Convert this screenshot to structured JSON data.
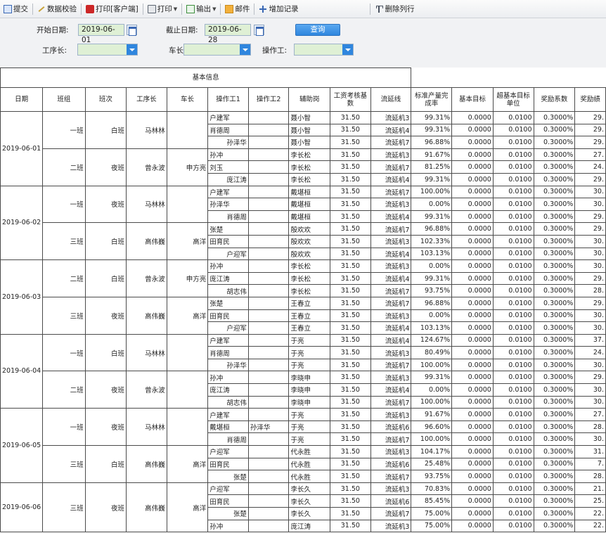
{
  "toolbar": {
    "submit": "提交",
    "validate": "数据校验",
    "print_client": "打印[客户端]",
    "print": "打印",
    "export": "输出",
    "mail": "邮件",
    "add_record": "增加记录",
    "delete_row": "删除列行"
  },
  "filters": {
    "start_label": "开始日期:",
    "start_value": "2019-06-01",
    "end_label": "截止日期:",
    "end_value": "2019-06-28",
    "query_label": "查询",
    "process_leader_label": "工序长:",
    "workshop_leader_label": "车长:",
    "operator_label": "操作工:"
  },
  "grid": {
    "group_header": "基本信息",
    "columns": [
      "日期",
      "班组",
      "班次",
      "工序长",
      "车长",
      "操作工1",
      "操作工2",
      "辅助岗",
      "工资考核基数",
      "流延线",
      "标准产量完成率",
      "基本目标",
      "超基本目标单位",
      "奖励系数",
      "奖励绩"
    ],
    "rows": [
      [
        "户建军",
        "",
        "聂小智",
        "31.50",
        "流延机3",
        "99.31%",
        "0.0000",
        "0.0100",
        "0.3000%",
        "29."
      ],
      [
        "肖德周",
        "",
        "聂小智",
        "31.50",
        "流延机4",
        "99.31%",
        "0.0000",
        "0.0100",
        "0.3000%",
        "29."
      ],
      [
        "孙泽华",
        "",
        "聂小智",
        "31.50",
        "流延机7",
        "96.88%",
        "0.0000",
        "0.0100",
        "0.3000%",
        "29."
      ],
      [
        "孙冲",
        "",
        "李长松",
        "31.50",
        "流延机3",
        "91.67%",
        "0.0000",
        "0.0100",
        "0.3000%",
        "27."
      ],
      [
        "刘玉",
        "",
        "李长松",
        "31.50",
        "流延机7",
        "81.25%",
        "0.0000",
        "0.0100",
        "0.3000%",
        "24."
      ],
      [
        "庞江涛",
        "",
        "李长松",
        "31.50",
        "流延机4",
        "99.31%",
        "0.0000",
        "0.0100",
        "0.3000%",
        "29."
      ],
      [
        "户建军",
        "",
        "戴堪桓",
        "31.50",
        "流延机7",
        "100.00%",
        "0.0000",
        "0.0100",
        "0.3000%",
        "30."
      ],
      [
        "孙泽华",
        "",
        "戴堪桓",
        "31.50",
        "流延机3",
        "0.00%",
        "0.0000",
        "0.0100",
        "0.3000%",
        "30."
      ],
      [
        "肖德周",
        "",
        "戴堪桓",
        "31.50",
        "流延机4",
        "99.31%",
        "0.0000",
        "0.0100",
        "0.3000%",
        "29."
      ],
      [
        "张楚",
        "",
        "殷欢欢",
        "31.50",
        "流延机7",
        "96.88%",
        "0.0000",
        "0.0100",
        "0.3000%",
        "29."
      ],
      [
        "田育民",
        "",
        "殷欢欢",
        "31.50",
        "流延机3",
        "102.33%",
        "0.0000",
        "0.0100",
        "0.3000%",
        "30."
      ],
      [
        "户迎军",
        "",
        "殷欢欢",
        "31.50",
        "流延机4",
        "103.13%",
        "0.0000",
        "0.0100",
        "0.3000%",
        "30."
      ],
      [
        "孙冲",
        "",
        "李长松",
        "31.50",
        "流延机3",
        "0.00%",
        "0.0000",
        "0.0100",
        "0.3000%",
        "30."
      ],
      [
        "庞江涛",
        "",
        "李长松",
        "31.50",
        "流延机4",
        "99.31%",
        "0.0000",
        "0.0100",
        "0.3000%",
        "29."
      ],
      [
        "胡志伟",
        "",
        "李长松",
        "31.50",
        "流延机7",
        "93.75%",
        "0.0000",
        "0.0100",
        "0.3000%",
        "28."
      ],
      [
        "张楚",
        "",
        "王春立",
        "31.50",
        "流延机7",
        "96.88%",
        "0.0000",
        "0.0100",
        "0.3000%",
        "29."
      ],
      [
        "田育民",
        "",
        "王春立",
        "31.50",
        "流延机3",
        "0.00%",
        "0.0000",
        "0.0100",
        "0.3000%",
        "30."
      ],
      [
        "户迎军",
        "",
        "王春立",
        "31.50",
        "流延机4",
        "103.13%",
        "0.0000",
        "0.0100",
        "0.3000%",
        "30."
      ],
      [
        "户建军",
        "",
        "于亮",
        "31.50",
        "流延机4",
        "124.67%",
        "0.0000",
        "0.0100",
        "0.3000%",
        "37."
      ],
      [
        "肖德周",
        "",
        "于亮",
        "31.50",
        "流延机3",
        "80.49%",
        "0.0000",
        "0.0100",
        "0.3000%",
        "24."
      ],
      [
        "孙泽华",
        "",
        "于亮",
        "31.50",
        "流延机7",
        "100.00%",
        "0.0000",
        "0.0100",
        "0.3000%",
        "30."
      ],
      [
        "孙冲",
        "",
        "李晓申",
        "31.50",
        "流延机3",
        "99.31%",
        "0.0000",
        "0.0100",
        "0.3000%",
        "29."
      ],
      [
        "庞江涛",
        "",
        "李晓申",
        "31.50",
        "流延机4",
        "0.00%",
        "0.0000",
        "0.0100",
        "0.3000%",
        "30."
      ],
      [
        "胡志伟",
        "",
        "李晓申",
        "31.50",
        "流延机7",
        "100.00%",
        "0.0000",
        "0.0100",
        "0.3000%",
        "30."
      ],
      [
        "户建军",
        "",
        "于亮",
        "31.50",
        "流延机3",
        "91.67%",
        "0.0000",
        "0.0100",
        "0.3000%",
        "27."
      ],
      [
        "戴堪桓",
        "孙泽华",
        "于亮",
        "31.50",
        "流延机6",
        "96.60%",
        "0.0000",
        "0.0100",
        "0.3000%",
        "28."
      ],
      [
        "肖德周",
        "",
        "于亮",
        "31.50",
        "流延机7",
        "100.00%",
        "0.0000",
        "0.0100",
        "0.3000%",
        "30."
      ],
      [
        "户迎军",
        "",
        "代永胜",
        "31.50",
        "流延机3",
        "104.17%",
        "0.0000",
        "0.0100",
        "0.3000%",
        "31."
      ],
      [
        "田育民",
        "",
        "代永胜",
        "31.50",
        "流延机6",
        "25.48%",
        "0.0000",
        "0.0100",
        "0.3000%",
        "7."
      ],
      [
        "张楚",
        "",
        "代永胜",
        "31.50",
        "流延机7",
        "93.75%",
        "0.0000",
        "0.0100",
        "0.3000%",
        "28."
      ],
      [
        "户迎军",
        "",
        "李长久",
        "31.50",
        "流延机3",
        "70.83%",
        "0.0000",
        "0.0100",
        "0.3000%",
        "21."
      ],
      [
        "田育民",
        "",
        "李长久",
        "31.50",
        "流延机6",
        "85.45%",
        "0.0000",
        "0.0100",
        "0.3000%",
        "25."
      ],
      [
        "张楚",
        "",
        "李长久",
        "31.50",
        "流延机7",
        "75.00%",
        "0.0000",
        "0.0100",
        "0.3000%",
        "22."
      ],
      [
        "孙冲",
        "",
        "庞江涛",
        "31.50",
        "流延机3",
        "75.00%",
        "0.0000",
        "0.0100",
        "0.3000%",
        "22."
      ]
    ],
    "groups": [
      {
        "date": "2019-06-01",
        "team": "一班",
        "shift": "白班",
        "proc": "马林林",
        "car": "",
        "start": 0,
        "span": 3
      },
      {
        "date": "",
        "team": "二班",
        "shift": "夜班",
        "proc": "曾永波",
        "car": "申方亮",
        "start": 3,
        "span": 3
      },
      {
        "date": "2019-06-02",
        "team": "一班",
        "shift": "夜班",
        "proc": "马林林",
        "car": "",
        "start": 6,
        "span": 3
      },
      {
        "date": "",
        "team": "三班",
        "shift": "白班",
        "proc": "高伟巍",
        "car": "高洋",
        "start": 9,
        "span": 3
      },
      {
        "date": "2019-06-03",
        "team": "二班",
        "shift": "白班",
        "proc": "曾永波",
        "car": "申方亮",
        "start": 12,
        "span": 3
      },
      {
        "date": "",
        "team": "三班",
        "shift": "夜班",
        "proc": "高伟巍",
        "car": "高洋",
        "start": 15,
        "span": 3
      },
      {
        "date": "2019-06-04",
        "team": "一班",
        "shift": "白班",
        "proc": "马林林",
        "car": "",
        "start": 18,
        "span": 3
      },
      {
        "date": "",
        "team": "二班",
        "shift": "夜班",
        "proc": "曾永波",
        "car": "",
        "start": 21,
        "span": 3
      },
      {
        "date": "2019-06-05",
        "team": "一班",
        "shift": "夜班",
        "proc": "马林林",
        "car": "",
        "start": 24,
        "span": 3
      },
      {
        "date": "",
        "team": "三班",
        "shift": "白班",
        "proc": "高伟巍",
        "car": "高洋",
        "start": 27,
        "span": 3
      },
      {
        "date": "2019-06-06",
        "team": "三班",
        "shift": "夜班",
        "proc": "高伟巍",
        "car": "高洋",
        "start": 30,
        "span": 4
      }
    ]
  }
}
